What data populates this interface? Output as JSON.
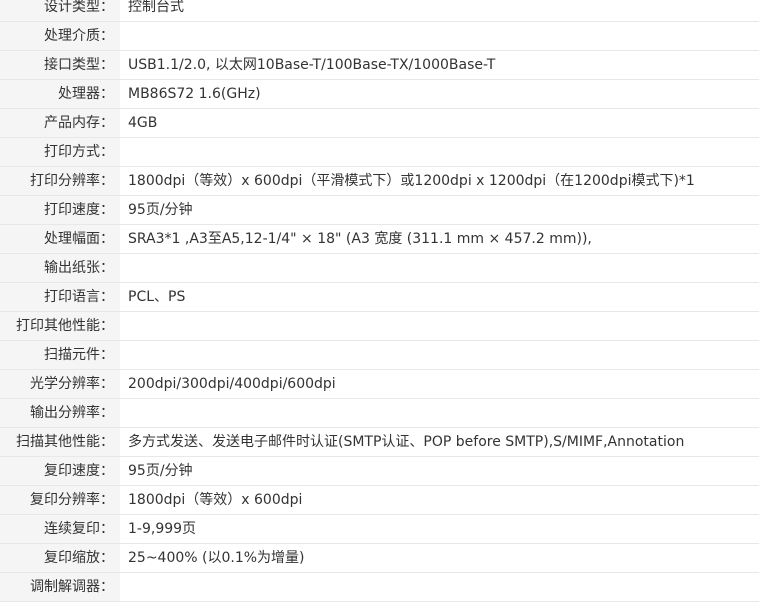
{
  "specs": [
    {
      "label": "设计类型：",
      "value": "控制台式"
    },
    {
      "label": "处理介质：",
      "value": ""
    },
    {
      "label": "接口类型：",
      "value": "USB1.1/2.0, 以太网10Base-T/100Base-TX/1000Base-T"
    },
    {
      "label": "处理器：",
      "value": "MB86S72 1.6(GHz)"
    },
    {
      "label": "产品内存：",
      "value": "4GB"
    },
    {
      "label": "打印方式：",
      "value": ""
    },
    {
      "label": "打印分辨率：",
      "value": "1800dpi（等效）x 600dpi（平滑模式下）或1200dpi x 1200dpi（在1200dpi模式下)*1"
    },
    {
      "label": "打印速度：",
      "value": "95页/分钟"
    },
    {
      "label": "处理幅面：",
      "value": "SRA3*1 ,A3至A5,12-1/4\" × 18\" (A3 宽度 (311.1 mm × 457.2 mm)),"
    },
    {
      "label": "输出纸张：",
      "value": ""
    },
    {
      "label": "打印语言：",
      "value": "PCL、PS"
    },
    {
      "label": "打印其他性能：",
      "value": ""
    },
    {
      "label": "扫描元件：",
      "value": ""
    },
    {
      "label": "光学分辨率：",
      "value": "200dpi/300dpi/400dpi/600dpi"
    },
    {
      "label": "输出分辨率：",
      "value": ""
    },
    {
      "label": "扫描其他性能：",
      "value": "多方式发送、发送电子邮件时认证(SMTP认证、POP before SMTP),S/MIMF,Annotation"
    },
    {
      "label": "复印速度：",
      "value": "95页/分钟"
    },
    {
      "label": "复印分辨率：",
      "value": "1800dpi（等效）x 600dpi"
    },
    {
      "label": "连续复印：",
      "value": "1-9,999页"
    },
    {
      "label": "复印缩放：",
      "value": "25~400% (以0.1%为增量)"
    },
    {
      "label": "调制解调器：",
      "value": ""
    }
  ]
}
